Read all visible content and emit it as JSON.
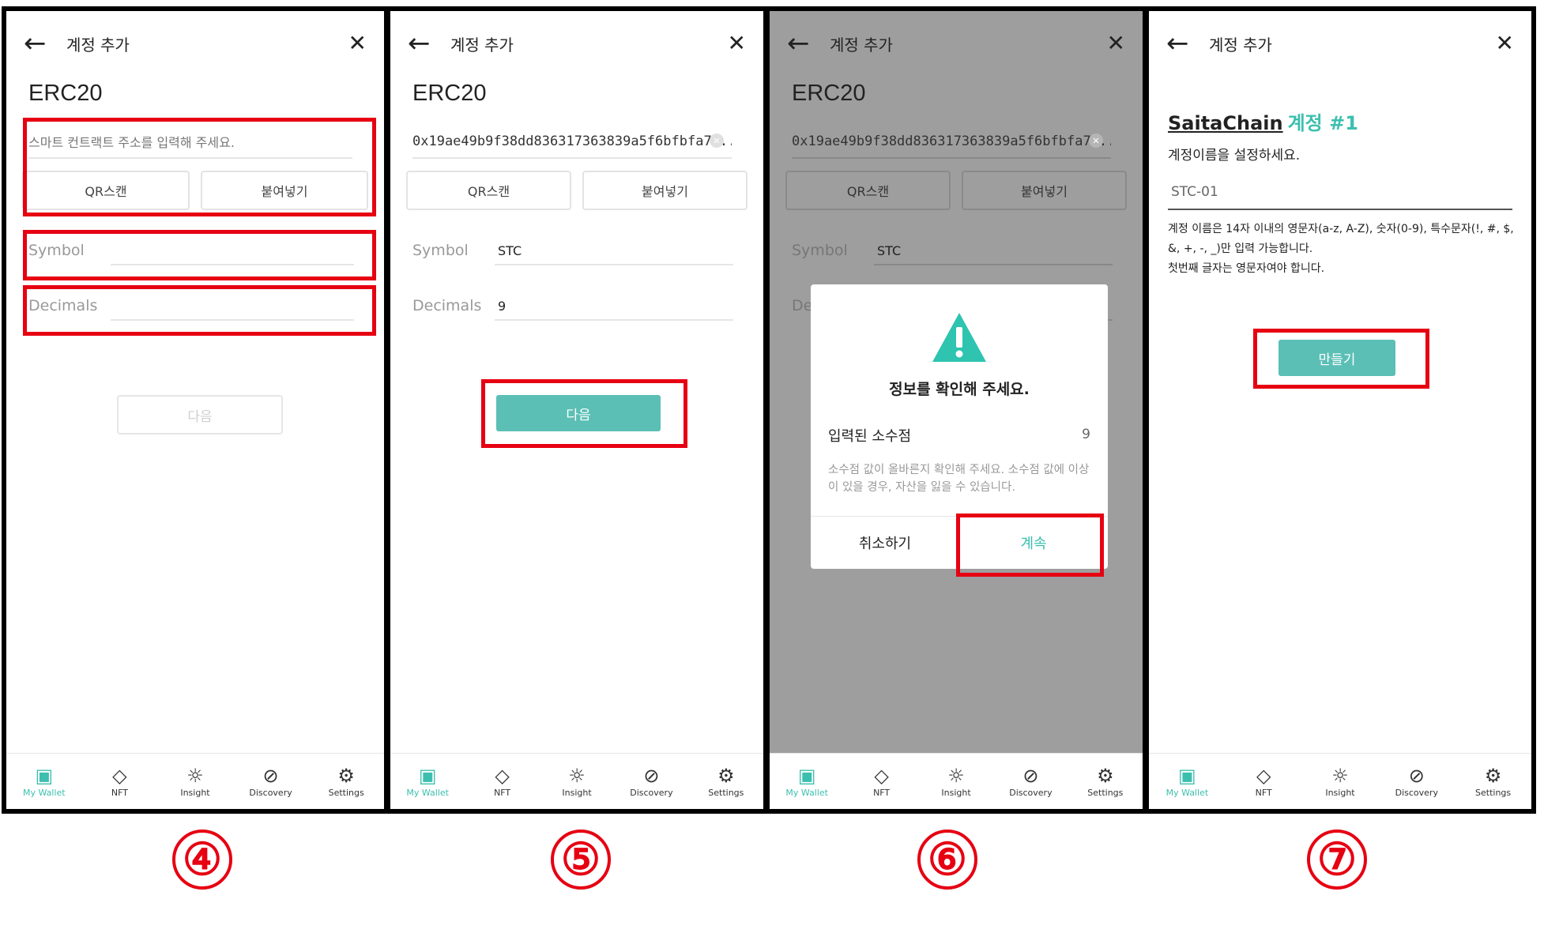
{
  "header": {
    "back_icon": "arrow-left-icon",
    "title": "계정 추가",
    "close_icon": "close-icon"
  },
  "network": "ERC20",
  "address": {
    "placeholder": "스마트 컨트랙트 주소를 입력해 주세요.",
    "value": "0x19ae49b9f38dd836317363839a5f6bfbfa7..."
  },
  "buttons": {
    "qr_scan": "QR스캔",
    "paste": "붙여넣기",
    "next": "다음",
    "create": "만들기"
  },
  "fields": {
    "symbol_label": "Symbol",
    "symbol_value": "STC",
    "decimals_label": "Decimals",
    "decimals_value": "9",
    "decimals_label_partial": "De"
  },
  "dialog": {
    "title": "정보를 확인해 주세요.",
    "decimal_label": "입력된 소수점",
    "decimal_value": "9",
    "note": "소수점 값이 올바른지 확인해 주세요. 소수점 값에 이상이 있을 경우, 자산을 잃을 수 있습니다.",
    "cancel": "취소하기",
    "continue": "계속"
  },
  "account": {
    "chain": "SaitaChain",
    "account_no": "계정 #1",
    "prompt": "계정이름을 설정하세요.",
    "name": "STC-01",
    "rules_1": "계정 이름은 14자 이내의 영문자(a-z, A-Z), 숫자(0-9), 특수문자(!, #, $, &, +, -, _)만 입력 가능합니다.",
    "rules_2": "첫번째 글자는 영문자여야 합니다."
  },
  "nav": [
    {
      "label": "My Wallet",
      "icon": "wallet-icon",
      "active": true
    },
    {
      "label": "NFT",
      "icon": "diamond-icon",
      "active": false
    },
    {
      "label": "Insight",
      "icon": "lightbulb-icon",
      "active": false
    },
    {
      "label": "Discovery",
      "icon": "compass-icon",
      "active": false
    },
    {
      "label": "Settings",
      "icon": "gear-icon",
      "active": false
    }
  ],
  "steps": [
    "④",
    "⑤",
    "⑥",
    "⑦"
  ],
  "colors": {
    "accent": "#3cbfae",
    "button": "#5bbfb5",
    "highlight": "#e60012",
    "overlay": "#9e9e9e"
  }
}
